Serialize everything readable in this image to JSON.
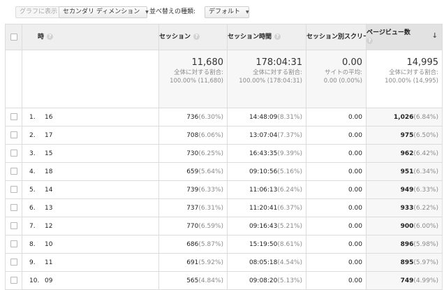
{
  "toolbar": {
    "show_graph_label": "グラフに表示",
    "secondary_dimension_label": "セカンダリ ディメンション",
    "sort_type_label": "並べ替えの種類:",
    "sort_type_value": "デフォルト"
  },
  "columns": {
    "dimension": "時",
    "sessions": "セッション",
    "session_duration": "セッション時間",
    "screens_per_session": "セッション別スクリーン数",
    "pageviews": "ページビュー数"
  },
  "summary": {
    "sessions": {
      "value": "11,680",
      "label": "全体に対する割合:",
      "detail": "100.00% (11,680)"
    },
    "session_duration": {
      "value": "178:04:31",
      "label": "全体に対する割合:",
      "detail": "100.00% (178:04:31)"
    },
    "screens_per_session": {
      "value": "0.00",
      "label": "サイトの平均:",
      "detail": "0.00 (0.00%)"
    },
    "pageviews": {
      "value": "14,995",
      "label": "全体に対する割合:",
      "detail": "100.00% (14,995)"
    }
  },
  "rows": [
    {
      "rank": "1.",
      "hour": "16",
      "sessions": "736",
      "sessions_pct": "(6.30%)",
      "duration": "14:48:09",
      "duration_pct": "(8.31%)",
      "screens": "0.00",
      "pageviews": "1,026",
      "pageviews_pct": "(6.84%)"
    },
    {
      "rank": "2.",
      "hour": "17",
      "sessions": "708",
      "sessions_pct": "(6.06%)",
      "duration": "13:07:04",
      "duration_pct": "(7.37%)",
      "screens": "0.00",
      "pageviews": "975",
      "pageviews_pct": "(6.50%)"
    },
    {
      "rank": "3.",
      "hour": "15",
      "sessions": "730",
      "sessions_pct": "(6.25%)",
      "duration": "16:43:35",
      "duration_pct": "(9.39%)",
      "screens": "0.00",
      "pageviews": "962",
      "pageviews_pct": "(6.42%)"
    },
    {
      "rank": "4.",
      "hour": "18",
      "sessions": "659",
      "sessions_pct": "(5.64%)",
      "duration": "09:10:56",
      "duration_pct": "(5.16%)",
      "screens": "0.00",
      "pageviews": "951",
      "pageviews_pct": "(6.34%)"
    },
    {
      "rank": "5.",
      "hour": "14",
      "sessions": "739",
      "sessions_pct": "(6.33%)",
      "duration": "11:06:13",
      "duration_pct": "(6.24%)",
      "screens": "0.00",
      "pageviews": "949",
      "pageviews_pct": "(6.33%)"
    },
    {
      "rank": "6.",
      "hour": "13",
      "sessions": "737",
      "sessions_pct": "(6.31%)",
      "duration": "11:20:41",
      "duration_pct": "(6.37%)",
      "screens": "0.00",
      "pageviews": "933",
      "pageviews_pct": "(6.22%)"
    },
    {
      "rank": "7.",
      "hour": "12",
      "sessions": "770",
      "sessions_pct": "(6.59%)",
      "duration": "09:16:43",
      "duration_pct": "(5.21%)",
      "screens": "0.00",
      "pageviews": "900",
      "pageviews_pct": "(6.00%)"
    },
    {
      "rank": "8.",
      "hour": "10",
      "sessions": "686",
      "sessions_pct": "(5.87%)",
      "duration": "15:19:50",
      "duration_pct": "(8.61%)",
      "screens": "0.00",
      "pageviews": "896",
      "pageviews_pct": "(5.98%)"
    },
    {
      "rank": "9.",
      "hour": "11",
      "sessions": "691",
      "sessions_pct": "(5.92%)",
      "duration": "08:05:18",
      "duration_pct": "(4.54%)",
      "screens": "0.00",
      "pageviews": "895",
      "pageviews_pct": "(5.97%)"
    },
    {
      "rank": "10.",
      "hour": "09",
      "sessions": "565",
      "sessions_pct": "(4.84%)",
      "duration": "09:08:20",
      "duration_pct": "(5.13%)",
      "screens": "0.00",
      "pageviews": "749",
      "pageviews_pct": "(4.99%)"
    }
  ]
}
